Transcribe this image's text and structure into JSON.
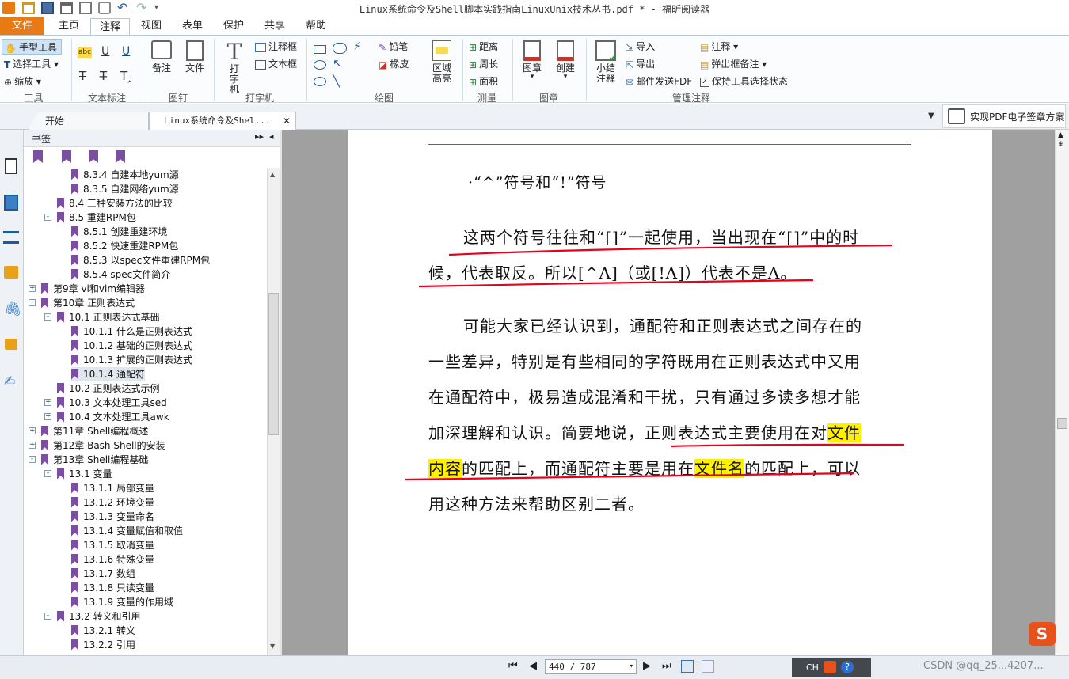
{
  "window": {
    "title": "Linux系统命令及Shell脚本实践指南LinuxUnix技术丛书.pdf * - 福昕阅读器"
  },
  "menu": {
    "tabs": [
      "文件",
      "主页",
      "注释",
      "视图",
      "表单",
      "保护",
      "共享",
      "帮助"
    ],
    "active": "注释"
  },
  "ribbon": {
    "tools": {
      "hand": "手型工具",
      "select": "选择工具",
      "zoom": "缩放",
      "group": "工具"
    },
    "text_markup": {
      "group": "文本标注"
    },
    "pin": {
      "note": "备注",
      "file": "文件",
      "group": "图钉"
    },
    "typewriter": {
      "type_label": "打字机",
      "callout": "注释框",
      "textbox": "文本框",
      "group": "打字机"
    },
    "drawing": {
      "pencil": "铅笔",
      "eraser": "橡皮",
      "area_highlight": "区域高亮",
      "group": "绘图"
    },
    "measure": {
      "distance": "距离",
      "perimeter": "周长",
      "area": "面积",
      "group": "测量"
    },
    "stamp": {
      "stamp": "图章",
      "create": "创建",
      "group": "图章"
    },
    "manage": {
      "summary": "小结注释",
      "import": "导入",
      "export": "导出",
      "email": "邮件发送FDF",
      "comment": "注释",
      "popup": "弹出框备注",
      "keep_tool": "保持工具选择状态",
      "group": "管理注释"
    }
  },
  "doc_tabs": {
    "start": "开始",
    "current": "Linux系统命令及Shel...",
    "promo": "实现PDF电子签章方案"
  },
  "bookmarks": {
    "title": "书签",
    "items": [
      {
        "level": 3,
        "label": "8.3.4 自建本地yum源"
      },
      {
        "level": 3,
        "label": "8.3.5 自建网络yum源"
      },
      {
        "level": 2,
        "label": "8.4 三种安装方法的比较"
      },
      {
        "level": 2,
        "label": "8.5 重建RPM包",
        "exp": "-"
      },
      {
        "level": 3,
        "label": "8.5.1 创建重建环境"
      },
      {
        "level": 3,
        "label": "8.5.2 快速重建RPM包"
      },
      {
        "level": 3,
        "label": "8.5.3 以spec文件重建RPM包"
      },
      {
        "level": 3,
        "label": "8.5.4 spec文件简介"
      },
      {
        "level": 1,
        "label": "第9章 vi和vim编辑器",
        "exp": "+"
      },
      {
        "level": 1,
        "label": "第10章 正则表达式",
        "exp": "-"
      },
      {
        "level": 2,
        "label": "10.1 正则表达式基础",
        "exp": "-"
      },
      {
        "level": 3,
        "label": "10.1.1 什么是正则表达式"
      },
      {
        "level": 3,
        "label": "10.1.2 基础的正则表达式"
      },
      {
        "level": 3,
        "label": "10.1.3 扩展的正则表达式"
      },
      {
        "level": 3,
        "label": "10.1.4 通配符",
        "selected": true
      },
      {
        "level": 2,
        "label": "10.2 正则表达式示例"
      },
      {
        "level": 2,
        "label": "10.3 文本处理工具sed",
        "exp": "+"
      },
      {
        "level": 2,
        "label": "10.4 文本处理工具awk",
        "exp": "+"
      },
      {
        "level": 1,
        "label": "第11章 Shell编程概述",
        "exp": "+"
      },
      {
        "level": 1,
        "label": "第12章 Bash Shell的安装",
        "exp": "+"
      },
      {
        "level": 1,
        "label": "第13章 Shell编程基础",
        "exp": "-"
      },
      {
        "level": 2,
        "label": "13.1 变量",
        "exp": "-"
      },
      {
        "level": 3,
        "label": "13.1.1 局部变量"
      },
      {
        "level": 3,
        "label": "13.1.2 环境变量"
      },
      {
        "level": 3,
        "label": "13.1.3 变量命名"
      },
      {
        "level": 3,
        "label": "13.1.4 变量赋值和取值"
      },
      {
        "level": 3,
        "label": "13.1.5 取消变量"
      },
      {
        "level": 3,
        "label": "13.1.6 特殊变量"
      },
      {
        "level": 3,
        "label": "13.1.7 数组"
      },
      {
        "level": 3,
        "label": "13.1.8 只读变量"
      },
      {
        "level": 3,
        "label": "13.1.9 变量的作用域"
      },
      {
        "level": 2,
        "label": "13.2 转义和引用",
        "exp": "-"
      },
      {
        "level": 3,
        "label": "13.2.1 转义"
      },
      {
        "level": 3,
        "label": "13.2.2 引用"
      }
    ]
  },
  "page": {
    "heading": "·“^”符号和“!”符号",
    "p1_l1": "这两个符号往往和“[]”一起使用，当出现在“[]”中的时",
    "p1_l2": "候，代表取反。所以[^A]（或[!A]）代表不是A。",
    "p2_l1": "可能大家已经认识到，通配符和正则表达式之间存在的",
    "p2_l2": "一些差异，特别是有些相同的字符既用在正则表达式中又用",
    "p2_l3": "在通配符中，极易造成混淆和干扰，只有通过多读多想才能",
    "p2_l4a": "加深理解和认识。简要地说，正则表达式主要使用在对",
    "p2_l4b": "文件",
    "p2_l5a": "内容",
    "p2_l5b": "的匹配上，而通配符主要是用在",
    "p2_l5c": "文件名",
    "p2_l5d": "的匹配上，可以",
    "p2_l6": "用这种方法来帮助区别二者。"
  },
  "status": {
    "page_input": "440 / 787",
    "ime": "CH",
    "watermark": "CSDN @qq_25...4207..."
  },
  "colors": {
    "accent": "#e77a14",
    "highlight": "#ffef00",
    "underline": "#e8001c",
    "bookmark": "#7b4fa0"
  }
}
